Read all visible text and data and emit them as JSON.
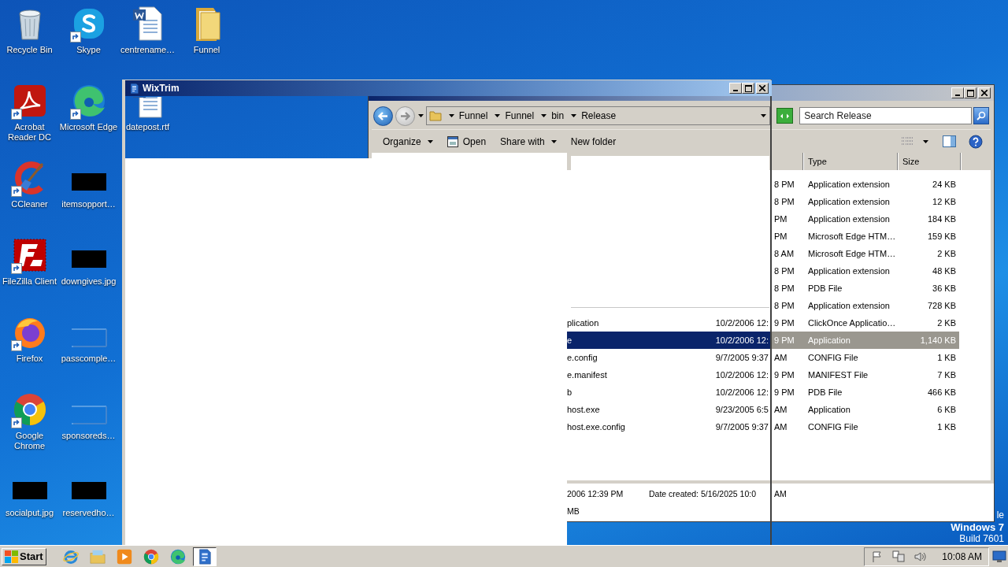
{
  "desktop": {
    "columns": [
      [
        {
          "kind": "recycle",
          "label": "Recycle Bin",
          "shortcut": false
        },
        {
          "kind": "acrobat",
          "label": "Acrobat Reader DC",
          "shortcut": true
        },
        {
          "kind": "ccleaner",
          "label": "CCleaner",
          "shortcut": true
        },
        {
          "kind": "filezilla",
          "label": "FileZilla Client",
          "shortcut": true
        },
        {
          "kind": "firefox",
          "label": "Firefox",
          "shortcut": true
        },
        {
          "kind": "chrome",
          "label": "Google Chrome",
          "shortcut": true
        },
        {
          "kind": "thumb-dark",
          "label": "socialput.jpg",
          "shortcut": false
        }
      ],
      [
        {
          "kind": "skype",
          "label": "Skype",
          "shortcut": true
        },
        {
          "kind": "edge",
          "label": "Microsoft Edge",
          "shortcut": true
        },
        {
          "kind": "thumb-dark",
          "label": "itemsopport…",
          "shortcut": false
        },
        {
          "kind": "thumb-dark",
          "label": "downgives.jpg",
          "shortcut": false
        },
        {
          "kind": "thumb-light",
          "label": "passcomple…",
          "shortcut": false
        },
        {
          "kind": "thumb-light",
          "label": "sponsoreds…",
          "shortcut": false
        },
        {
          "kind": "thumb-dark",
          "label": "reservedho…",
          "shortcut": false
        }
      ],
      [
        {
          "kind": "word",
          "label": "centrename…",
          "shortcut": false
        },
        {
          "kind": "word",
          "label": "datepost.rtf",
          "shortcut": false
        }
      ],
      [
        {
          "kind": "folder",
          "label": "Funnel",
          "shortcut": false
        }
      ]
    ],
    "os_notice": [
      "le",
      "Windows 7",
      "Build 7601"
    ]
  },
  "explorer": {
    "breadcrumb": [
      "Funnel",
      "Funnel",
      "bin",
      "Release"
    ],
    "search": {
      "placeholder": "Search Release"
    },
    "toolbar": [
      {
        "kind": "menu",
        "label": "Organize"
      },
      {
        "kind": "open",
        "label": "Open"
      },
      {
        "kind": "menu",
        "label": "Share with"
      },
      {
        "kind": "plain",
        "label": "New folder"
      }
    ],
    "columns": [
      "Type",
      "Size"
    ],
    "rows": [
      {
        "date_tail": "8 PM",
        "type": "Application extension",
        "size": "24 KB",
        "selected": false
      },
      {
        "date_tail": "8 PM",
        "type": "Application extension",
        "size": "12 KB",
        "selected": false
      },
      {
        "date_tail": "PM",
        "type": "Application extension",
        "size": "184 KB",
        "selected": false
      },
      {
        "date_tail": "PM",
        "type": "Microsoft Edge HTM…",
        "size": "159 KB",
        "selected": false
      },
      {
        "date_tail": "8 AM",
        "type": "Microsoft Edge HTM…",
        "size": "2 KB",
        "selected": false
      },
      {
        "date_tail": "8 PM",
        "type": "Application extension",
        "size": "48 KB",
        "selected": false
      },
      {
        "date_tail": "8 PM",
        "type": "PDB File",
        "size": "36 KB",
        "selected": false
      },
      {
        "date_tail": "8 PM",
        "type": "Application extension",
        "size": "728 KB",
        "selected": false
      },
      {
        "name": "plication",
        "date": "10/2/2006 12:",
        "date_tail": "9 PM",
        "type": "ClickOnce Applicatio…",
        "size": "2 KB",
        "selected": false
      },
      {
        "name": "e",
        "date": "10/2/2006 12:",
        "date_tail": "9 PM",
        "type": "Application",
        "size": "1,140 KB",
        "selected": true
      },
      {
        "name": "e.config",
        "date": "9/7/2005 9:37",
        "date_tail": "AM",
        "type": "CONFIG File",
        "size": "1 KB",
        "selected": false
      },
      {
        "name": "e.manifest",
        "date": "10/2/2006 12:",
        "date_tail": "9 PM",
        "type": "MANIFEST File",
        "size": "7 KB",
        "selected": false
      },
      {
        "name": "b",
        "date": "10/2/2006 12:",
        "date_tail": "9 PM",
        "type": "PDB File",
        "size": "466 KB",
        "selected": false
      },
      {
        "name": "host.exe",
        "date": "9/23/2005 6:5",
        "date_tail": "AM",
        "type": "Application",
        "size": "6 KB",
        "selected": false
      },
      {
        "name": "host.exe.config",
        "date": "9/7/2005 9:37",
        "date_tail": "AM",
        "type": "CONFIG File",
        "size": "1 KB",
        "selected": false
      }
    ],
    "details": {
      "modified": "2006 12:39 PM",
      "created": "Date created: 5/16/2025 10:0",
      "created_tail": "AM",
      "size": "MB"
    }
  },
  "wixtrim": {
    "title": "WixTrim"
  },
  "taskbar": {
    "start": "Start",
    "items": [
      {
        "kind": "ie",
        "selected": false
      },
      {
        "kind": "explorer",
        "selected": false
      },
      {
        "kind": "media",
        "selected": false
      },
      {
        "kind": "chrome",
        "selected": false
      },
      {
        "kind": "edge",
        "selected": false
      },
      {
        "kind": "wixtrim",
        "selected": true
      }
    ],
    "clock": "10:08 AM"
  }
}
